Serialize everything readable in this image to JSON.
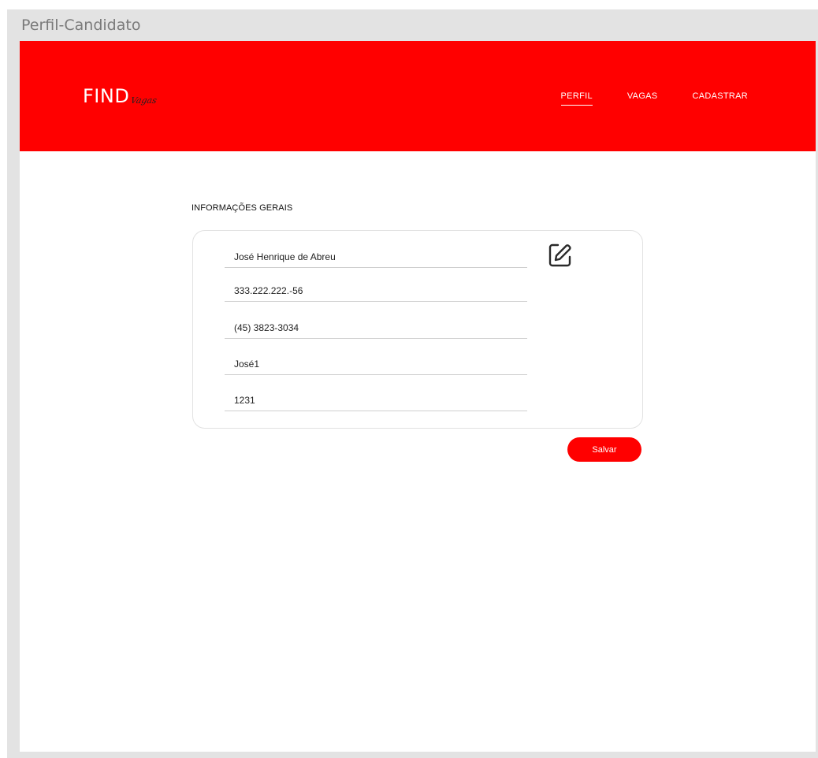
{
  "window": {
    "title": "Perfil-Candidato"
  },
  "header": {
    "logo_main": "FIND",
    "logo_script": "Vagas",
    "nav": [
      {
        "label": "PERFIL",
        "active": true
      },
      {
        "label": "VAGAS",
        "active": false
      },
      {
        "label": "CADASTRAR",
        "active": false
      }
    ]
  },
  "main": {
    "section_title": "INFORMAÇÕES GERAIS",
    "fields": [
      {
        "value": "José Henrique de Abreu"
      },
      {
        "value": "333.222.222.-56"
      },
      {
        "value": "(45) 3823-3034"
      },
      {
        "value": "José1"
      },
      {
        "value": "1231"
      }
    ],
    "edit_icon": "edit-pencil-icon",
    "save_label": "Salvar"
  },
  "colors": {
    "brand": "#ff0000",
    "frame": "#e3e3e3"
  }
}
